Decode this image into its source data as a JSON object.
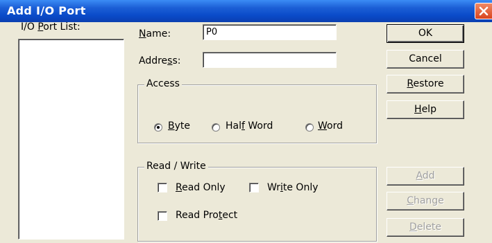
{
  "window": {
    "title": "Add I/O Port",
    "close_icon": "close-x-icon"
  },
  "port_list": {
    "label_pre": "I/O ",
    "label_key": "P",
    "label_post": "ort List:",
    "items": []
  },
  "name_field": {
    "label_key": "N",
    "label_rest": "ame:",
    "value": "P0"
  },
  "address_field": {
    "label_pre": "Addre",
    "label_key": "s",
    "label_post": "s:",
    "value": ""
  },
  "access": {
    "legend": "Access",
    "selected": "Byte",
    "byte_key": "B",
    "byte_rest": "yte",
    "halfword_pre": "Hal",
    "halfword_key": "f",
    "halfword_post": " Word",
    "word_key": "W",
    "word_rest": "ord"
  },
  "read_write": {
    "legend": "Read / Write",
    "read_only_key": "R",
    "read_only_rest": "ead Only",
    "read_only_checked": false,
    "write_only_pre": "Wr",
    "write_only_key": "i",
    "write_only_post": "te Only",
    "write_only_checked": false,
    "read_protect_pre": "Read Pro",
    "read_protect_key": "t",
    "read_protect_post": "ect",
    "read_protect_checked": false
  },
  "buttons": {
    "ok": "OK",
    "cancel": "Cancel",
    "restore_key": "R",
    "restore_rest": "estore",
    "help_key": "H",
    "help_rest": "elp",
    "add_key": "A",
    "add_rest": "dd",
    "change_key": "C",
    "change_rest": "hange",
    "delete_key": "D",
    "delete_rest": "elete"
  }
}
